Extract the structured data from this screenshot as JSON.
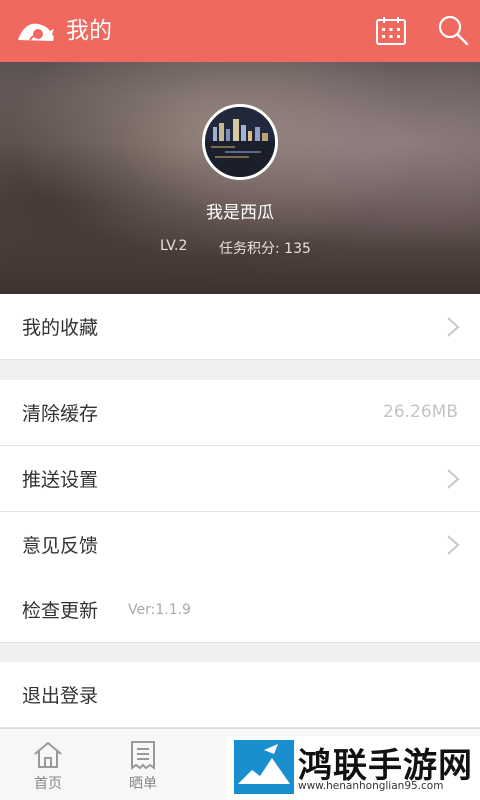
{
  "header": {
    "title": "我的",
    "icons": [
      "logo-icon",
      "calendar-icon",
      "search-icon"
    ],
    "bg_color": "#f0695f"
  },
  "profile": {
    "username": "我是西瓜",
    "level": "LV.2",
    "points": "任务积分: 135"
  },
  "menu": {
    "favorites": "我的收藏",
    "clear_cache": "清除缓存",
    "cache_size": "26.26MB",
    "push_settings": "推送设置",
    "feedback": "意见反馈",
    "check_update": "检查更新",
    "version": "Ver:1.1.9",
    "logout": "退出登录"
  },
  "tabs": [
    {
      "label": "首页",
      "icon": "home-icon"
    },
    {
      "label": "晒单",
      "icon": "receipt-icon"
    }
  ],
  "watermark": {
    "title": "鸿联手游网",
    "url": "www.henanhonglian95.com"
  }
}
